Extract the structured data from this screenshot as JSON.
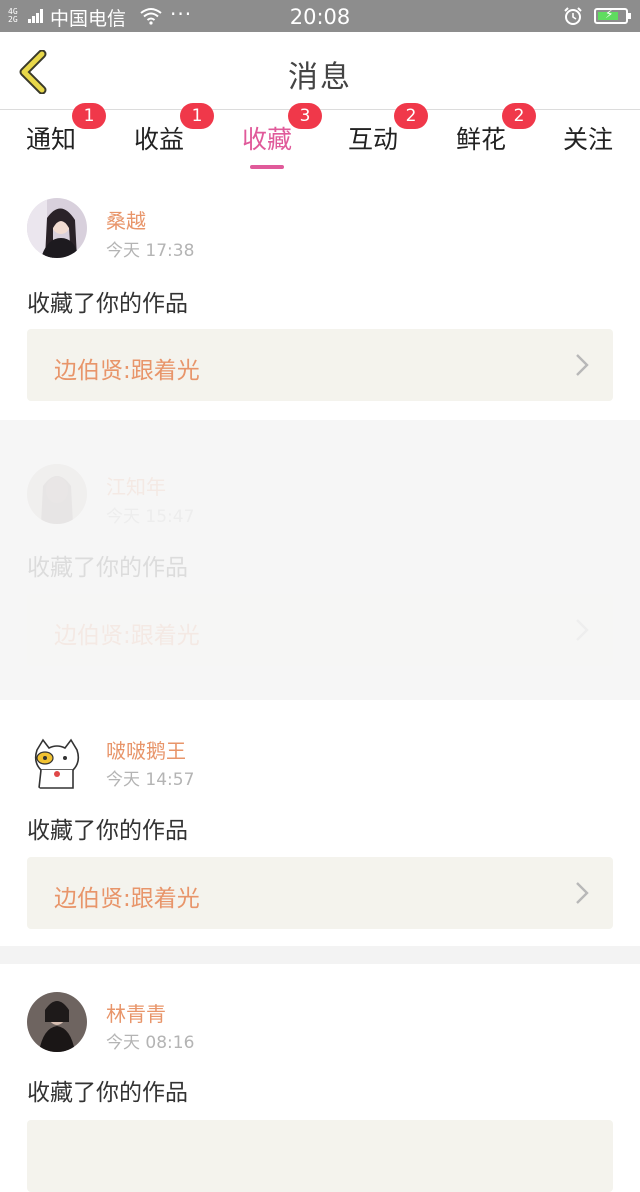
{
  "status_bar": {
    "network": "4G\n2G",
    "carrier": "中国电信",
    "more": "···",
    "time": "20:08",
    "alarm_icon": "alarm-clock-icon",
    "battery_icon": "battery-charging-icon"
  },
  "nav": {
    "title": "消息",
    "back_icon": "chevron-left-icon",
    "accent_color": "#e8d84a"
  },
  "tabs": [
    {
      "label": "通知",
      "badge": "1"
    },
    {
      "label": "收益",
      "badge": "1"
    },
    {
      "label": "收藏",
      "badge": "3",
      "active": true
    },
    {
      "label": "互动",
      "badge": "2"
    },
    {
      "label": "鲜花",
      "badge": "2"
    },
    {
      "label": "关注",
      "badge": ""
    }
  ],
  "messages": [
    {
      "name": "桑越",
      "time": "今天 17:38",
      "action": "收藏了你的作品",
      "work": "边伯贤:跟着光",
      "avatar": "avatar-photo-girl",
      "faded": false
    },
    {
      "name": "江知年",
      "time": "今天 15:47",
      "action": "收藏了你的作品",
      "work": "边伯贤:跟着光",
      "avatar": "avatar-photo-girl-2",
      "faded": true
    },
    {
      "name": "啵啵鹅王",
      "time": "今天 14:57",
      "action": "收藏了你的作品",
      "work": "边伯贤:跟着光",
      "avatar": "avatar-cartoon-cat",
      "faded": false
    },
    {
      "name": "林青青",
      "time": "今天 08:16",
      "action": "收藏了你的作品",
      "work": "",
      "avatar": "avatar-photo-dark",
      "faded": false
    }
  ],
  "colors": {
    "active_tab": "#e05a9a",
    "name": "#e8956a",
    "badge": "#f0384a",
    "work_bg": "#f4f3ed"
  }
}
